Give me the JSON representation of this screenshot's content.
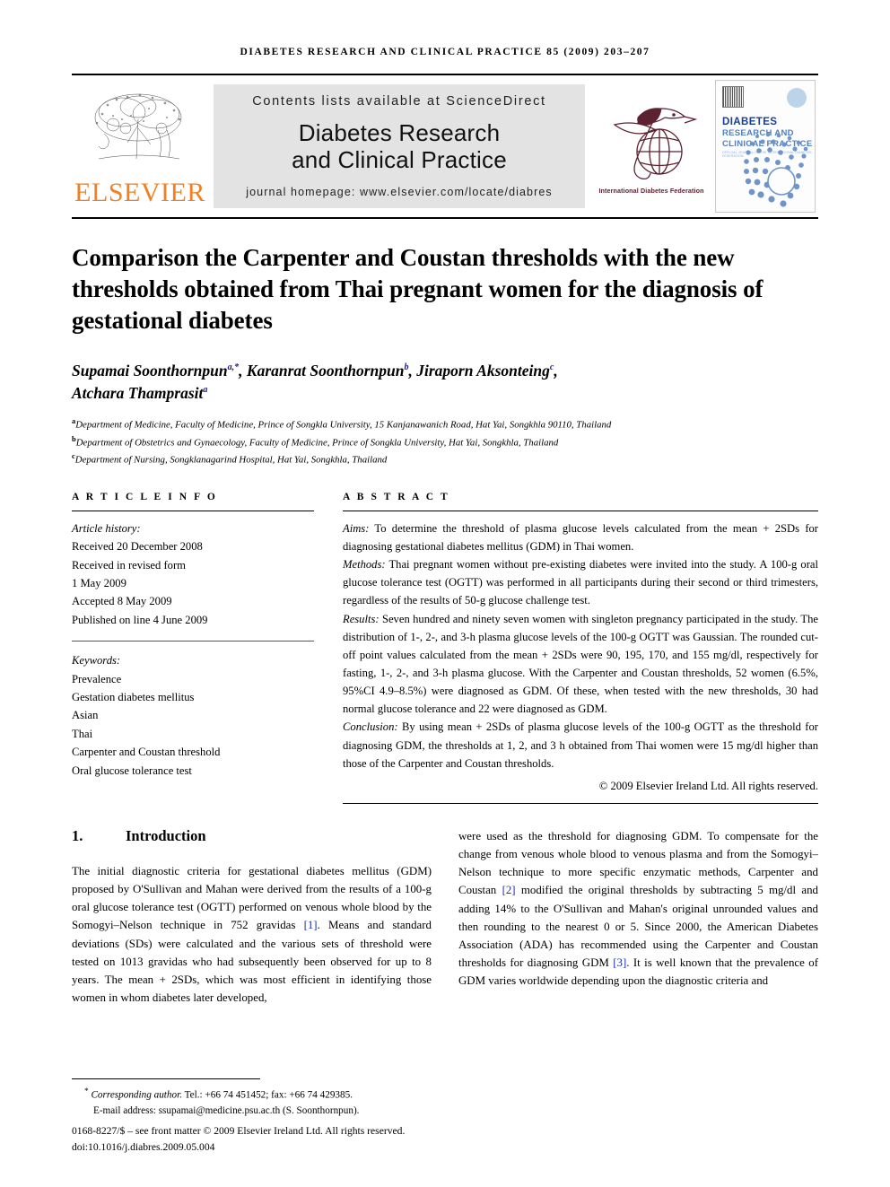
{
  "running_head": "DIABETES RESEARCH AND CLINICAL PRACTICE 85 (2009) 203–207",
  "masthead": {
    "publisher_name": "ELSEVIER",
    "sciencedirect_line": "Contents lists available at ScienceDirect",
    "journal_title_line1": "Diabetes Research",
    "journal_title_line2": "and Clinical Practice",
    "homepage_line": "journal homepage: www.elsevier.com/locate/diabres",
    "idf_caption": "International Diabetes Federation",
    "cover": {
      "line1": "DIABETES",
      "line2": "RESEARCH AND",
      "line3": "CLINICAL PRACTICE",
      "subline": "OFFICIAL JOURNAL OF THE INTERNATIONAL DIABETES FEDERATION"
    }
  },
  "article": {
    "title": "Comparison the Carpenter and Coustan thresholds with the new thresholds obtained from Thai pregnant women for the diagnosis of gestational diabetes",
    "authors_line1_a": "Supamai Soonthornpun",
    "authors_line1_a_sup": "a,*",
    "authors_line1_b": ", Karanrat Soonthornpun",
    "authors_line1_b_sup": "b",
    "authors_line1_c": ", Jiraporn Aksonteing",
    "authors_line1_c_sup": "c",
    "authors_line1_end": ",",
    "authors_line2": "Atchara Thamprasit",
    "authors_line2_sup": "a",
    "affiliations": [
      {
        "sup": "a",
        "text": "Department of Medicine, Faculty of Medicine, Prince of Songkla University, 15 Kanjanawanich Road, Hat Yai, Songkhla 90110, Thailand"
      },
      {
        "sup": "b",
        "text": "Department of Obstetrics and Gynaecology, Faculty of Medicine, Prince of Songkla University, Hat Yai, Songkhla, Thailand"
      },
      {
        "sup": "c",
        "text": "Department of Nursing, Songklanagarind Hospital, Hat Yai, Songkhla, Thailand"
      }
    ]
  },
  "article_info": {
    "heading": "A R T I C L E  I N F O",
    "history_label": "Article history:",
    "history": [
      "Received 20 December 2008",
      "Received in revised form",
      "1 May 2009",
      "Accepted 8 May 2009",
      "Published on line 4 June 2009"
    ],
    "keywords_label": "Keywords:",
    "keywords": [
      "Prevalence",
      "Gestation diabetes mellitus",
      "Asian",
      "Thai",
      "Carpenter and Coustan threshold",
      "Oral glucose tolerance test"
    ]
  },
  "abstract": {
    "heading": "A B S T R A C T",
    "aims_label": "Aims:",
    "aims_text": " To determine the threshold of plasma glucose levels calculated from the mean + 2SDs for diagnosing gestational diabetes mellitus (GDM) in Thai women.",
    "methods_label": "Methods:",
    "methods_text": " Thai pregnant women without pre-existing diabetes were invited into the study. A 100-g oral glucose tolerance test (OGTT) was performed in all participants during their second or third trimesters, regardless of the results of 50-g glucose challenge test.",
    "results_label": "Results:",
    "results_text": " Seven hundred and ninety seven women with singleton pregnancy participated in the study. The distribution of 1-, 2-, and 3-h plasma glucose levels of the 100-g OGTT was Gaussian. The rounded cut-off point values calculated from the mean + 2SDs were 90, 195, 170, and 155 mg/dl, respectively for fasting, 1-, 2-, and 3-h plasma glucose. With the Carpenter and Coustan thresholds, 52 women (6.5%, 95%CI 4.9–8.5%) were diagnosed as GDM. Of these, when tested with the new thresholds, 30 had normal glucose tolerance and 22 were diagnosed as GDM.",
    "conclusion_label": "Conclusion:",
    "conclusion_text": " By using mean + 2SDs of plasma glucose levels of the 100-g OGTT as the threshold for diagnosing GDM, the thresholds at 1, 2, and 3 h obtained from Thai women were 15 mg/dl higher than those of the Carpenter and Coustan thresholds.",
    "copyright": "© 2009 Elsevier Ireland Ltd. All rights reserved."
  },
  "section": {
    "number": "1.",
    "title": "Introduction",
    "left_p1_part1": "The initial diagnostic criteria for gestational diabetes mellitus (GDM) proposed by O'Sullivan and Mahan were derived from the results of a 100-g oral glucose tolerance test (OGTT) performed on venous whole blood by the Somogyi–Nelson technique in 752 gravidas ",
    "left_ref1": "[1]",
    "left_p1_part2": ". Means and standard deviations (SDs) were calculated and the various sets of threshold were tested on 1013 gravidas who had subsequently been observed for up to 8 years. The mean + 2SDs, which was most efficient in identifying those women in whom diabetes later developed,",
    "right_part1": "were used as the threshold for diagnosing GDM. To compensate for the change from venous whole blood to venous plasma and from the Somogyi–Nelson technique to more specific enzymatic methods, Carpenter and Coustan ",
    "right_ref2": "[2]",
    "right_part2": " modified the original thresholds by subtracting 5 mg/dl and adding 14% to the O'Sullivan and Mahan's original unrounded values and then rounding to the nearest 0 or 5. Since 2000, the American Diabetes Association (ADA) has recommended using the Carpenter and Coustan thresholds for diagnosing GDM ",
    "right_ref3": "[3]",
    "right_part3": ". It is well known that the prevalence of GDM varies worldwide depending upon the diagnostic criteria and"
  },
  "footnote": {
    "star": "*",
    "corresponding_label": "Corresponding author.",
    "corresponding_contact": " Tel.: +66 74 451452; fax: +66 74 429385.",
    "email_label": "E-mail address:",
    "email": "ssupamai@medicine.psu.ac.th",
    "email_owner": " (S. Soonthornpun).",
    "issn_line": "0168-8227/$ – see front matter © 2009 Elsevier Ireland Ltd. All rights reserved.",
    "doi_label": "doi:",
    "doi": "10.1016/j.diabres.2009.05.004"
  },
  "colors": {
    "elsevier_orange": "#F08020",
    "idf_maroon": "#5c2230",
    "link_blue": "#1a2fb0",
    "cover_blue": "#1b3f8f"
  }
}
